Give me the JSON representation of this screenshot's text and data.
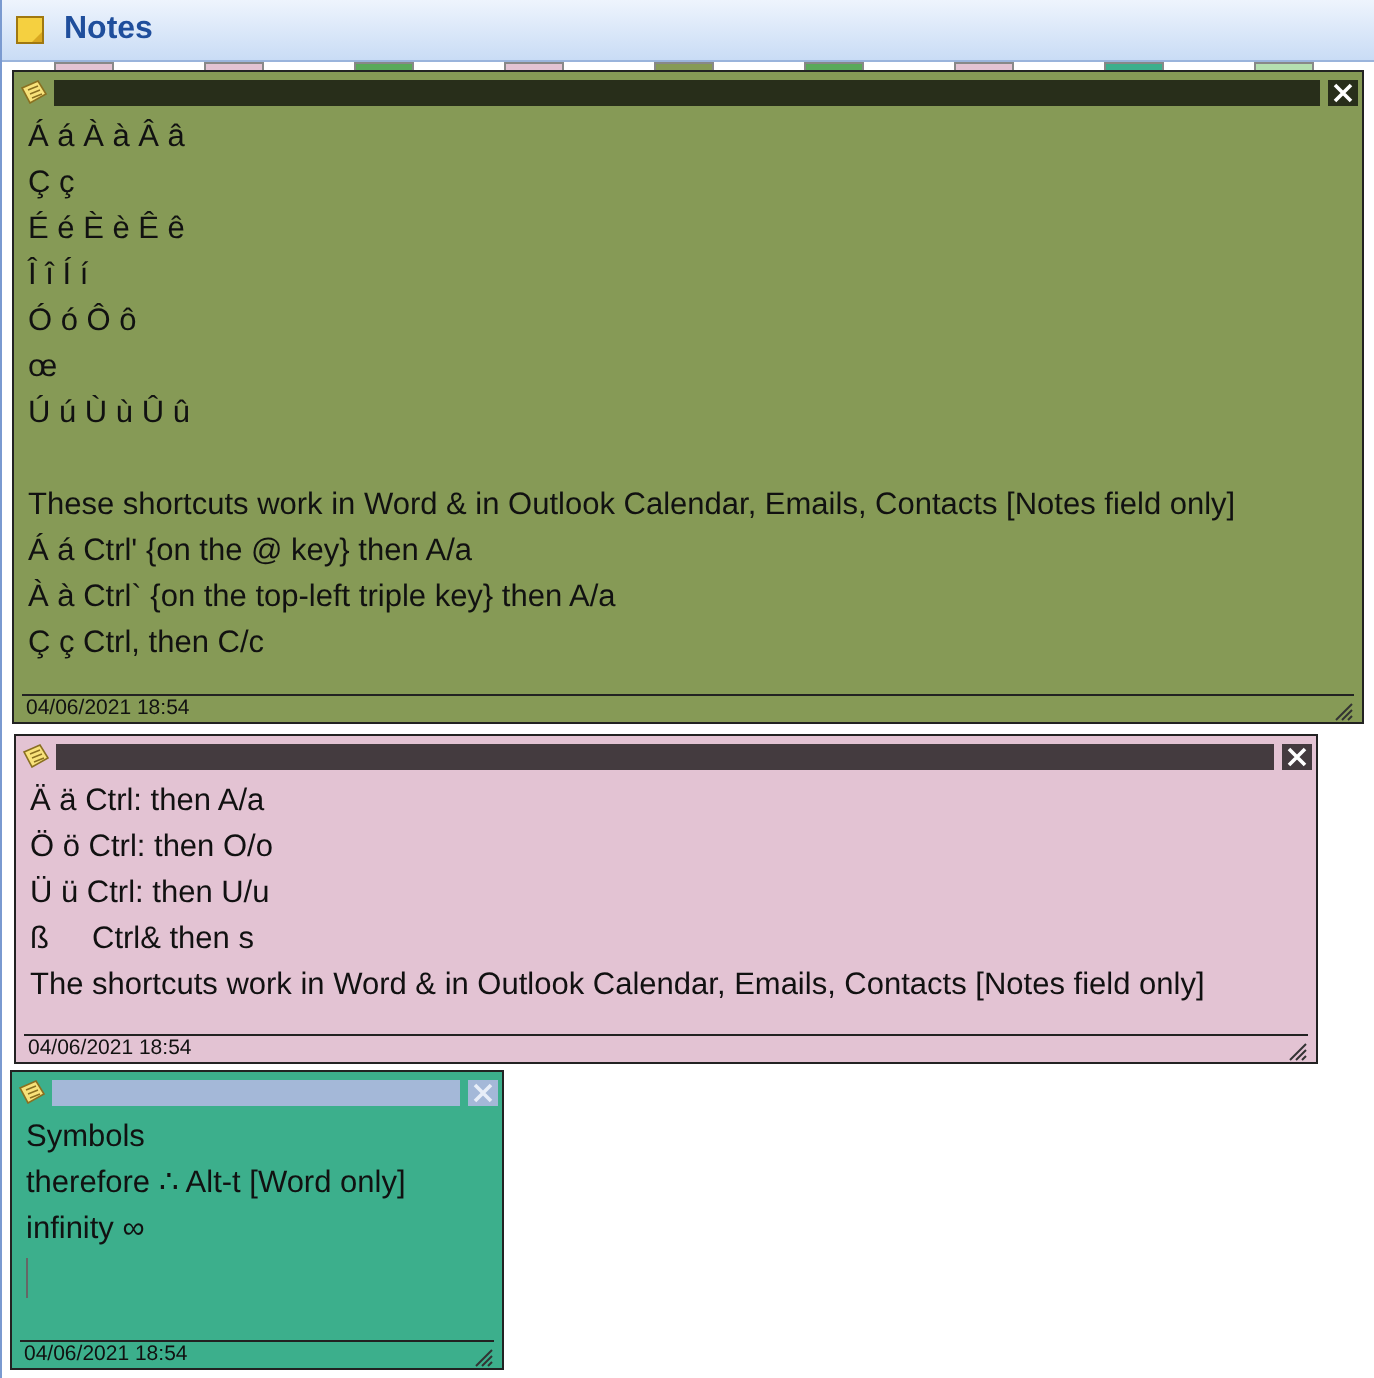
{
  "window": {
    "title": "Notes"
  },
  "stacked_tabs": [
    {
      "color": "#e3c3d3"
    },
    {
      "color": "#e3c3d3"
    },
    {
      "color": "#5aa95a"
    },
    {
      "color": "#e3c3d3"
    },
    {
      "color": "#869a56"
    },
    {
      "color": "#5aa95a"
    },
    {
      "color": "#e3c3d3"
    },
    {
      "color": "#3caf8c"
    },
    {
      "color": "#b5dfb0"
    }
  ],
  "notes": [
    {
      "color": "#869a56",
      "active": false,
      "caret": false,
      "date": "04/06/2021 18:54",
      "blocks": [
        [
          "Á á À à Â â",
          "Ç ç",
          "É é È è Ê ê",
          "Î î Í í",
          "Ó ó Ô ô",
          "œ",
          "Ú ú Ù ù Û û"
        ],
        [
          "These shortcuts work in Word & in Outlook Calendar, Emails, Contacts [Notes field only]",
          "Á á Ctrl' {on the @ key} then A/a",
          "À à Ctrl` {on the top-left triple key} then A/a",
          "Ç ç Ctrl, then C/c"
        ]
      ]
    },
    {
      "color": "#e3c3d3",
      "active": false,
      "caret": false,
      "date": "04/06/2021 18:54",
      "blocks": [
        [
          "Ä ä Ctrl: then A/a",
          "Ö ö Ctrl: then O/o",
          "Ü ü Ctrl: then U/u",
          "ß     Ctrl& then s",
          "The shortcuts work in Word & in Outlook Calendar, Emails, Contacts [Notes field only]"
        ]
      ]
    },
    {
      "color": "#3caf8c",
      "active": true,
      "caret": true,
      "date": "04/06/2021 18:54",
      "blocks": [
        [
          "Symbols",
          "therefore ∴ Alt-t [Word only]",
          "infinity ∞"
        ]
      ]
    }
  ]
}
